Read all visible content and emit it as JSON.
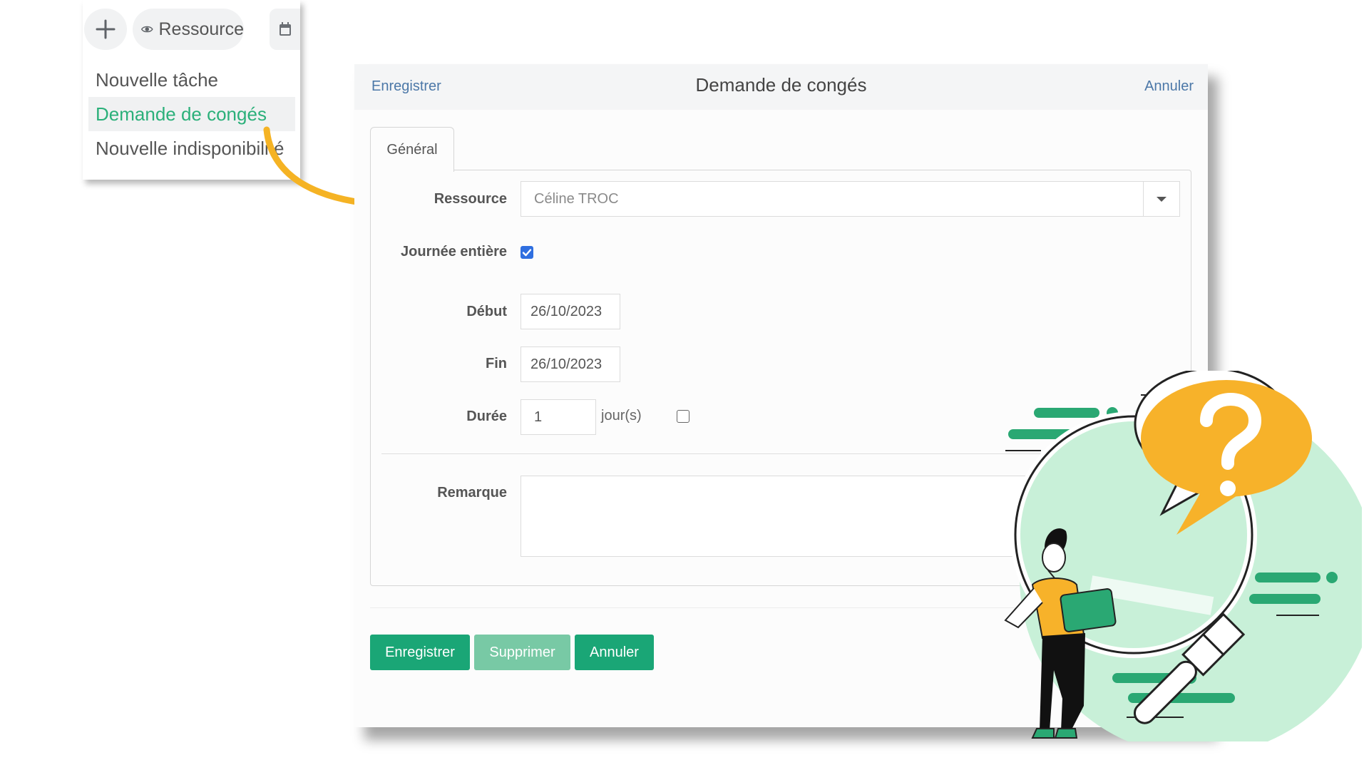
{
  "menu": {
    "toolbar": {
      "add_icon": "plus-icon",
      "resource_icon": "eye-icon",
      "resource_label": "Ressource",
      "calendar_icon": "calendar-icon"
    },
    "items": [
      {
        "label": "Nouvelle tâche",
        "active": false
      },
      {
        "label": "Demande de congés",
        "active": true
      },
      {
        "label": "Nouvelle indisponibilité",
        "active": false
      }
    ]
  },
  "dialog": {
    "header": {
      "save_label": "Enregistrer",
      "title": "Demande de congés",
      "cancel_label": "Annuler"
    },
    "tabs": [
      {
        "label": "Général",
        "active": true
      }
    ],
    "form": {
      "resource": {
        "label": "Ressource",
        "value": "Céline TROC"
      },
      "full_day": {
        "label": "Journée entière",
        "checked": true
      },
      "start": {
        "label": "Début",
        "value": "26/10/2023"
      },
      "end": {
        "label": "Fin",
        "value": "26/10/2023"
      },
      "duration": {
        "label": "Durée",
        "value": "1",
        "unit": "jour(s)",
        "half_day_checked": false
      },
      "remark": {
        "label": "Remarque",
        "value": ""
      }
    },
    "buttons": {
      "save": "Enregistrer",
      "delete": "Supprimer",
      "cancel": "Annuler"
    }
  },
  "colors": {
    "accent_green": "#1aa676",
    "menu_active_green": "#2bb07a",
    "link_blue": "#4c78a8",
    "arrow_yellow": "#f5b324",
    "illustration_mint": "#c8f0d8"
  }
}
